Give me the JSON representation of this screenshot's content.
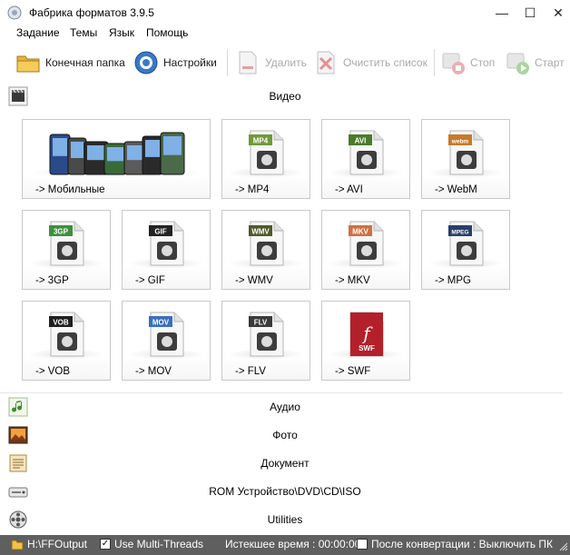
{
  "window": {
    "title": "Фабрика форматов 3.9.5",
    "min": "—",
    "max": "☐",
    "close": "✕"
  },
  "menu": [
    "Задание",
    "Темы",
    "Язык",
    "Помощь"
  ],
  "toolbar": {
    "output_folder": "Конечная папка",
    "settings": "Настройки",
    "delete": "Удалить",
    "clear_list": "Очистить список",
    "stop": "Стоп",
    "start": "Старт"
  },
  "categories": {
    "video": "Видео",
    "audio": "Аудио",
    "photo": "Фото",
    "document": "Документ",
    "rom": "ROM Устройство\\DVD\\CD\\ISO",
    "utilities": "Utilities"
  },
  "video_tiles": [
    {
      "label": "-> Мобильные",
      "badge": "",
      "color": "#555555"
    },
    {
      "label": "-> MP4",
      "badge": "MP4",
      "color": "#6d9a3a"
    },
    {
      "label": "-> AVI",
      "badge": "AVI",
      "color": "#4a7a2a"
    },
    {
      "label": "-> WebM",
      "badge": "webm",
      "color": "#c87a2a"
    },
    {
      "label": "-> 3GP",
      "badge": "3GP",
      "color": "#3f8f3f"
    },
    {
      "label": "-> GIF",
      "badge": "GIF",
      "color": "#222222"
    },
    {
      "label": "-> WMV",
      "badge": "WMV",
      "color": "#4f5a2a"
    },
    {
      "label": "-> MKV",
      "badge": "MKV",
      "color": "#d07040"
    },
    {
      "label": "-> MPG",
      "badge": "MPEG",
      "color": "#2a3f6a"
    },
    {
      "label": "-> VOB",
      "badge": "VOB",
      "color": "#1f1f1f"
    },
    {
      "label": "-> MOV",
      "badge": "MOV",
      "color": "#3a6fbf"
    },
    {
      "label": "-> FLV",
      "badge": "FLV",
      "color": "#3a3a3a"
    },
    {
      "label": "-> SWF",
      "badge": "SWF",
      "color": "#b3202a"
    }
  ],
  "status": {
    "output_path": "H:\\FFOutput",
    "multithreads": "Use Multi-Threads",
    "elapsed": "Истекшее время : 00:00:00",
    "after_convert": "После конвертации : Выключить ПК"
  }
}
